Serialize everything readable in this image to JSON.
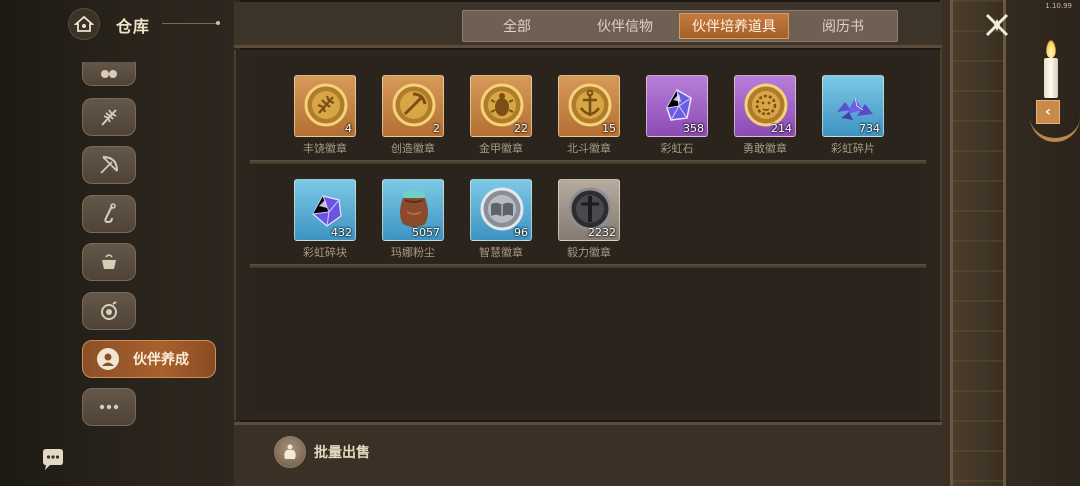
{
  "version": "1.10.99",
  "header": {
    "title": "仓库"
  },
  "tabs": [
    {
      "label": "全部",
      "active": false
    },
    {
      "label": "伙伴信物",
      "active": false
    },
    {
      "label": "伙伴培养道具",
      "active": true
    },
    {
      "label": "阅历书",
      "active": false
    }
  ],
  "sidebar": {
    "items": [
      {
        "icon": "bean-icon"
      },
      {
        "icon": "wheat-icon"
      },
      {
        "icon": "bow-icon"
      },
      {
        "icon": "anchor-icon"
      },
      {
        "icon": "cooking-pot-icon"
      },
      {
        "icon": "potion-icon"
      },
      {
        "icon": "partner-avatar-icon",
        "label": "伙伴养成",
        "active": true
      },
      {
        "icon": "more-icon"
      }
    ]
  },
  "items": [
    {
      "name": "丰饶徽章",
      "count": "4",
      "quality": "orange",
      "icon": "wheat-badge-icon"
    },
    {
      "name": "创造徽章",
      "count": "2",
      "quality": "orange",
      "icon": "pickaxe-badge-icon"
    },
    {
      "name": "金甲徽章",
      "count": "22",
      "quality": "orange",
      "icon": "beetle-badge-icon"
    },
    {
      "name": "北斗徽章",
      "count": "15",
      "quality": "orange",
      "icon": "anchor-badge-icon"
    },
    {
      "name": "彩虹石",
      "count": "358",
      "quality": "purple",
      "icon": "rainbow-gem-icon"
    },
    {
      "name": "勇敢徽章",
      "count": "214",
      "quality": "purple",
      "icon": "lion-badge-icon"
    },
    {
      "name": "彩虹碎片",
      "count": "734",
      "quality": "blue",
      "icon": "rainbow-shards-icon"
    },
    {
      "name": "彩虹碎块",
      "count": "432",
      "quality": "blue",
      "icon": "rainbow-chunk-icon"
    },
    {
      "name": "玛娜粉尘",
      "count": "5057",
      "quality": "blue",
      "icon": "mana-dust-bag-icon"
    },
    {
      "name": "智慧徽章",
      "count": "96",
      "quality": "blue",
      "icon": "book-badge-icon"
    },
    {
      "name": "毅力徽章",
      "count": "2232",
      "quality": "gray",
      "icon": "sword-badge-icon"
    }
  ],
  "bottom": {
    "sell_label": "批量出售"
  }
}
